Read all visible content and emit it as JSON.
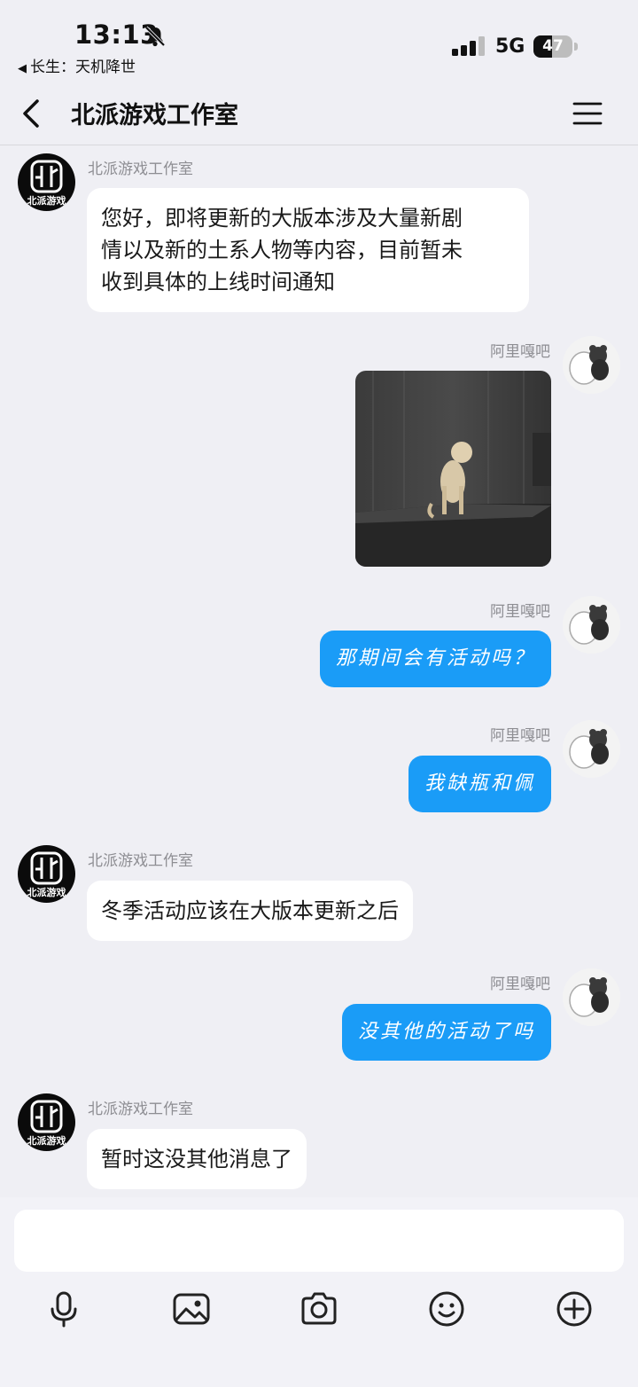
{
  "status_bar": {
    "time": "13:13",
    "back_app": "长生：天机降世",
    "network": "5G",
    "battery_level": "47",
    "battery_fraction": 0.47
  },
  "nav": {
    "title": "北派游戏工作室"
  },
  "studio_avatar_text": "北派游戏",
  "messages": [
    {
      "sender": "北派游戏工作室",
      "text_lines": [
        "您好，即将更新的大版本涉及大量新剧",
        "情以及新的土系人物等内容，目前暂未",
        "收到具体的上线时间通知"
      ]
    },
    {
      "sender": "阿里嘎吧"
    },
    {
      "sender": "阿里嘎吧",
      "text": "那期间会有活动吗？"
    },
    {
      "sender": "阿里嘎吧",
      "text": "我缺瓶和佩"
    },
    {
      "sender": "北派游戏工作室",
      "text": "冬季活动应该在大版本更新之后"
    },
    {
      "sender": "阿里嘎吧",
      "text": "没其他的活动了吗"
    },
    {
      "sender": "北派游戏工作室",
      "text": "暂时这没其他消息了"
    }
  ],
  "toolbar": {
    "icons": [
      "microphone-icon",
      "image-icon",
      "camera-icon",
      "emoji-icon",
      "plus-icon"
    ]
  },
  "colors": {
    "outgoing_bubble": "#1a9cf7",
    "incoming_bubble": "#ffffff",
    "background": "#efeff4"
  }
}
